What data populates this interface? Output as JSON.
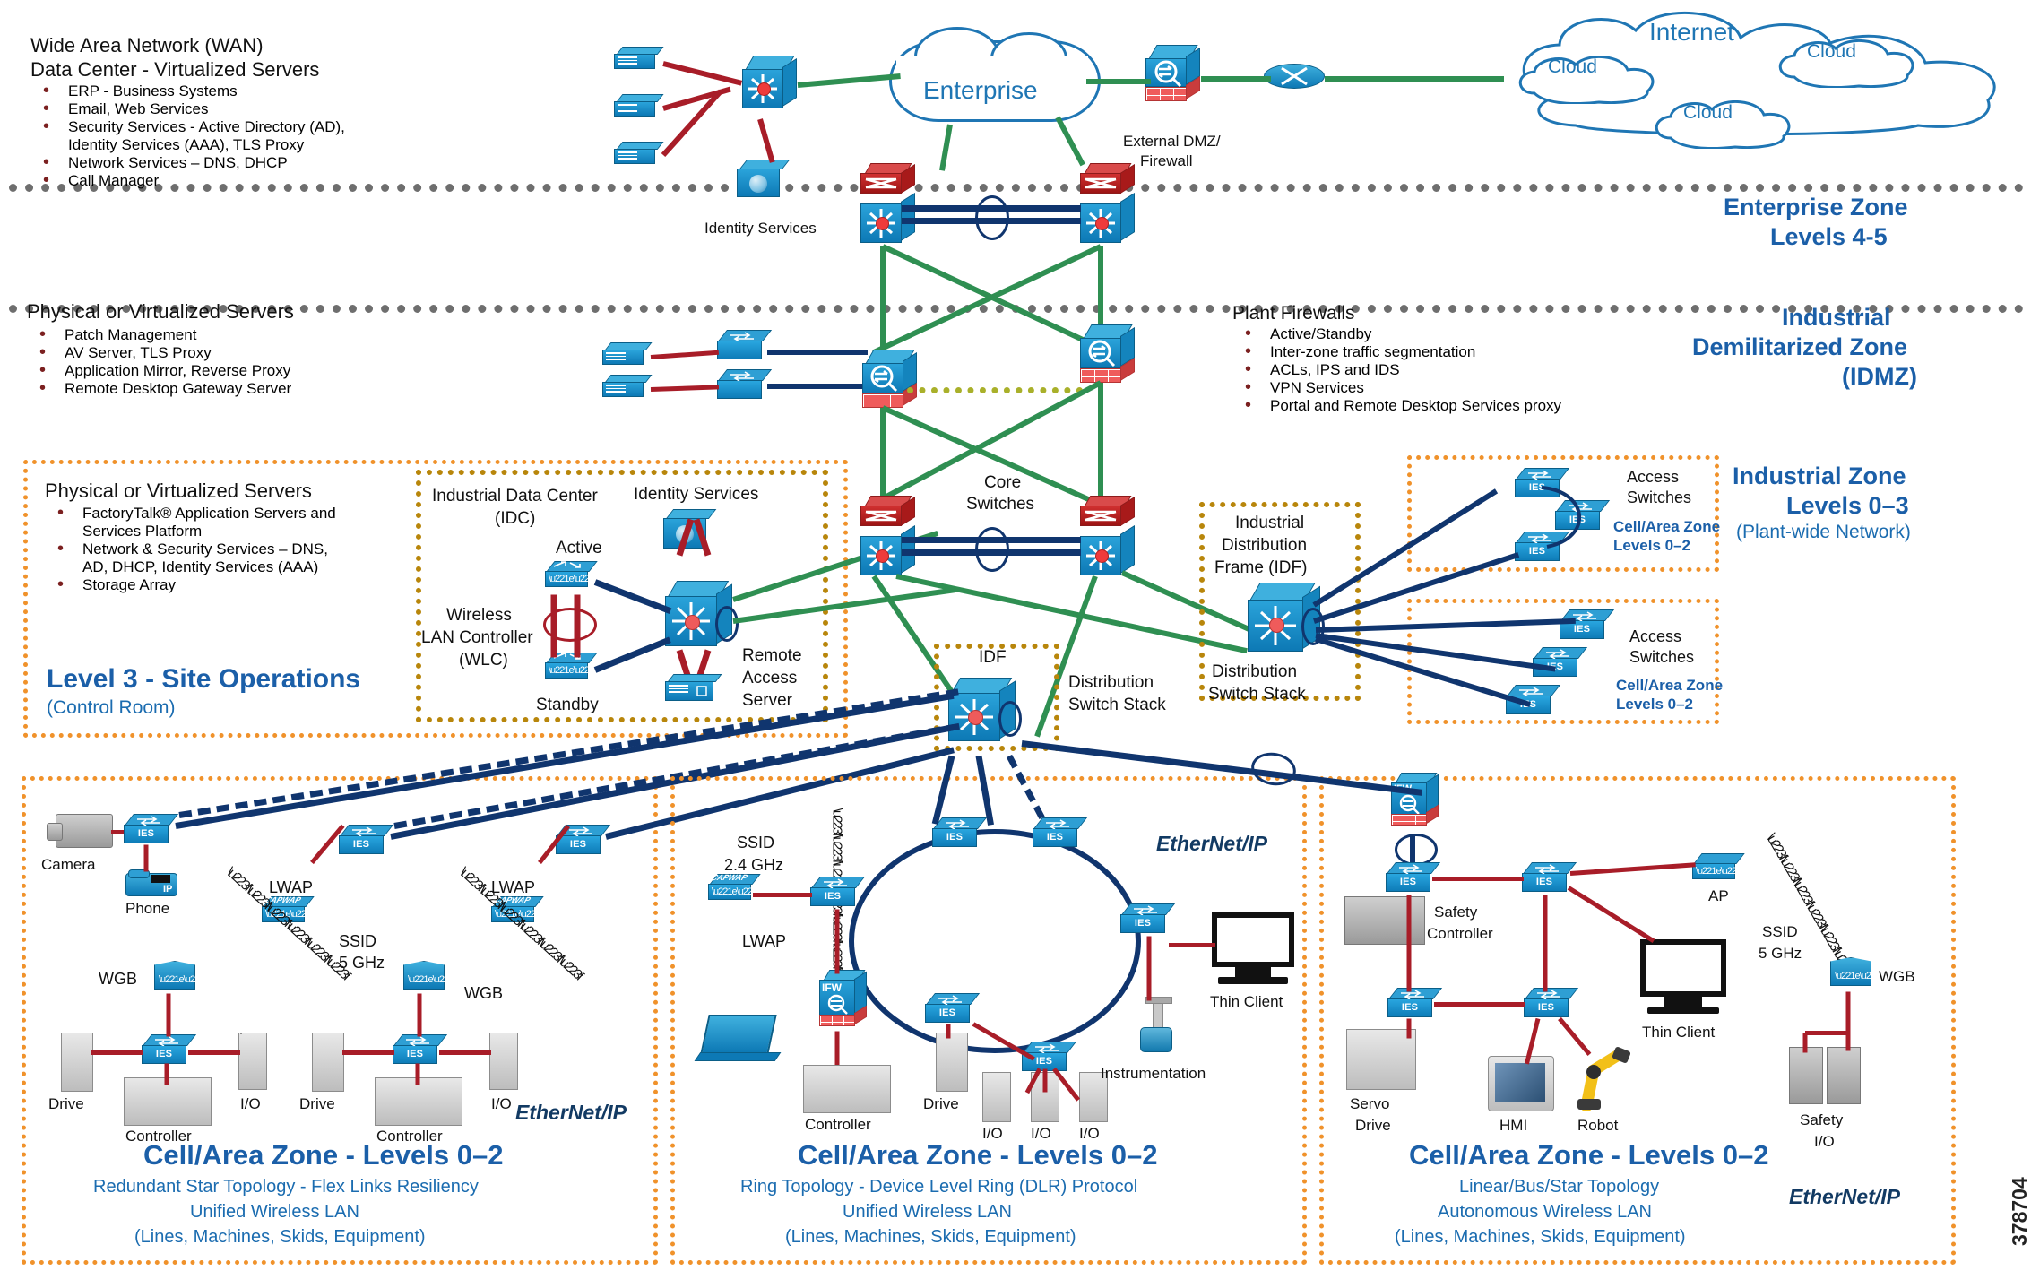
{
  "zones": {
    "enterprise": {
      "title": "Enterprise Zone",
      "levels": "Levels 4-5"
    },
    "idmz": {
      "line1": "Industrial",
      "line2": "Demilitarized Zone",
      "line3": "(IDMZ)"
    },
    "industrial": {
      "title": "Industrial Zone",
      "levels": "Levels 0–3",
      "sub": "(Plant-wide Network)"
    }
  },
  "enterprise_panel": {
    "heading1": "Wide Area Network (WAN)",
    "heading2": "Data Center - Virtualized Servers",
    "bullets": [
      "ERP - Business Systems",
      "Email, Web Services",
      "Security Services - Active Directory (AD),",
      "Identity Services (AAA), TLS Proxy",
      "Network Services – DNS, DHCP",
      "Call Manager"
    ],
    "labels": {
      "enterprise_cloud": "Enterprise",
      "identity_services": "Identity Services",
      "ext_dmz_fw_l1": "External DMZ/",
      "ext_dmz_fw_l2": "Firewall",
      "internet": "Internet",
      "cloud1": "Cloud",
      "cloud2": "Cloud",
      "cloud3": "Cloud"
    }
  },
  "idmz_panel": {
    "heading": "Physical or Virtualized Servers",
    "bullets": [
      "Patch Management",
      "AV Server, TLS Proxy",
      "Application Mirror, Reverse Proxy",
      "Remote Desktop Gateway Server"
    ],
    "firewalls_heading": "Plant Firewalls",
    "firewalls_bullets": [
      "Active/Standby",
      "Inter-zone traffic segmentation",
      "ACLs, IPS and IDS",
      "VPN Services",
      "Portal and Remote Desktop Services proxy"
    ]
  },
  "level3_panel": {
    "heading": "Physical or Virtualized Servers",
    "bullets": [
      "FactoryTalk® Application Servers and",
      "Services Platform",
      "Network & Security Services – DNS,",
      "AD, DHCP, Identity Services (AAA)",
      "Storage Array"
    ],
    "title": "Level 3 - Site Operations",
    "subtitle": "(Control Room)"
  },
  "idc_panel": {
    "title_l1": "Industrial Data Center",
    "title_l2": "(IDC)",
    "identity_services": "Identity Services",
    "active": "Active",
    "standby": "Standby",
    "wlc_l1": "Wireless",
    "wlc_l2": "LAN Controller",
    "wlc_l3": "(WLC)",
    "ras_l1": "Remote",
    "ras_l2": "Access",
    "ras_l3": "Server"
  },
  "industrial_core": {
    "core_l1": "Core",
    "core_l2": "Switches",
    "idf_label": "IDF",
    "idf_dist_l1": "Distribution",
    "idf_dist_l2": "Switch Stack",
    "idf_frame_l1": "Industrial",
    "idf_frame_l2": "Distribution",
    "idf_frame_l3": "Frame (IDF)",
    "idf_frame_dist_l1": "Distribution",
    "idf_frame_dist_l2": "Switch Stack"
  },
  "right_cells": [
    {
      "access_l1": "Access",
      "access_l2": "Switches",
      "zone_l1": "Cell/Area Zone",
      "zone_l2": "Levels 0–2",
      "switches": [
        "IES",
        "IES",
        "IES"
      ]
    },
    {
      "access_l1": "Access",
      "access_l2": "Switches",
      "zone_l1": "Cell/Area Zone",
      "zone_l2": "Levels 0–2",
      "switches": [
        "IES",
        "IES",
        "IES"
      ]
    }
  ],
  "cell_panels": [
    {
      "title": "Cell/Area Zone - Levels 0–2",
      "sub1": "Redundant Star Topology - Flex Links Resiliency",
      "sub2": "Unified Wireless LAN",
      "sub3": "(Lines, Machines, Skids, Equipment)",
      "eip": "EtherNet/IP",
      "devices": {
        "camera": "Camera",
        "phone": "Phone",
        "ies": "IES",
        "lwap1": "LWAP",
        "lwap2": "LWAP",
        "capwap": "CAPWAP",
        "ssid_l1": "SSID",
        "ssid_l2": "5 GHz",
        "wgb_left": "WGB",
        "wgb_right": "WGB",
        "drive1": "Drive",
        "drive2": "Drive",
        "io1": "I/O",
        "io2": "I/O",
        "controller1": "Controller",
        "controller2": "Controller"
      }
    },
    {
      "title": "Cell/Area Zone - Levels 0–2",
      "sub1": "Ring Topology - Device Level Ring (DLR) Protocol",
      "sub2": "Unified Wireless LAN",
      "sub3": "(Lines, Machines, Skids, Equipment)",
      "eip": "EtherNet/IP",
      "devices": {
        "ssid_l1": "SSID",
        "ssid_l2": "2.4 GHz",
        "capwap": "CAPWAP",
        "lwap": "LWAP",
        "ifw": "IFW",
        "ies": "IES",
        "controller": "Controller",
        "drive": "Drive",
        "io1": "I/O",
        "io2": "I/O",
        "io3": "I/O",
        "instrumentation": "Instrumentation",
        "thin_client": "Thin Client"
      }
    },
    {
      "title": "Cell/Area Zone - Levels 0–2",
      "sub1": "Linear/Bus/Star Topology",
      "sub2": "Autonomous Wireless LAN",
      "sub3": "(Lines, Machines, Skids, Equipment)",
      "eip": "EtherNet/IP",
      "devices": {
        "ifw": "IFW",
        "ies": "IES",
        "ap": "AP",
        "ssid_l1": "SSID",
        "ssid_l2": "5 GHz",
        "wgb": "WGB",
        "safety_controller_l1": "Safety",
        "safety_controller_l2": "Controller",
        "servo_l1": "Servo",
        "servo_l2": "Drive",
        "hmi": "HMI",
        "robot": "Robot",
        "thin_client": "Thin Client",
        "safety_io_l1": "Safety",
        "safety_io_l2": "I/O"
      }
    }
  ],
  "figure_number": "378704",
  "colors": {
    "zone_blue": "#1b5fa8",
    "orange": "#f0922b",
    "tan": "#b8860b",
    "link_blue": "#154b91",
    "link_green": "#2f8f52",
    "link_red": "#a81d28"
  }
}
